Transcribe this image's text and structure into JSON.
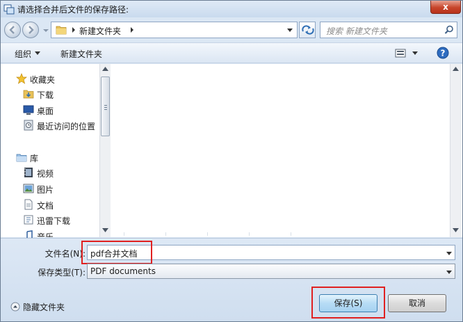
{
  "window": {
    "title": "请选择合并后文件的保存路径:",
    "close_label": "x"
  },
  "address_bar": {
    "current_folder": "新建文件夹",
    "search_placeholder": "搜索 新建文件夹"
  },
  "toolbar": {
    "organize_label": "组织",
    "new_folder_label": "新建文件夹"
  },
  "nav_pane": {
    "favorites": {
      "label": "收藏夹",
      "items": [
        {
          "label": "下载",
          "icon": "downloads-folder-icon"
        },
        {
          "label": "桌面",
          "icon": "desktop-icon"
        },
        {
          "label": "最近访问的位置",
          "icon": "recent-places-icon"
        }
      ]
    },
    "libraries": {
      "label": "库",
      "items": [
        {
          "label": "视频",
          "icon": "video-icon"
        },
        {
          "label": "图片",
          "icon": "pictures-icon"
        },
        {
          "label": "文档",
          "icon": "documents-icon"
        },
        {
          "label": "迅雷下载",
          "icon": "thunder-download-icon"
        },
        {
          "label": "音乐",
          "icon": "music-icon"
        }
      ]
    }
  },
  "form": {
    "filename_label": "文件名(N):",
    "filename_value": "pdf合并文档",
    "filetype_label": "保存类型(T):",
    "filetype_value": "PDF documents"
  },
  "footer": {
    "hide_folders_label": "隐藏文件夹",
    "save_button": "保存(S)",
    "cancel_button": "取消"
  },
  "colors": {
    "highlight_border": "#e02020",
    "accent": "#3c7fb1"
  }
}
